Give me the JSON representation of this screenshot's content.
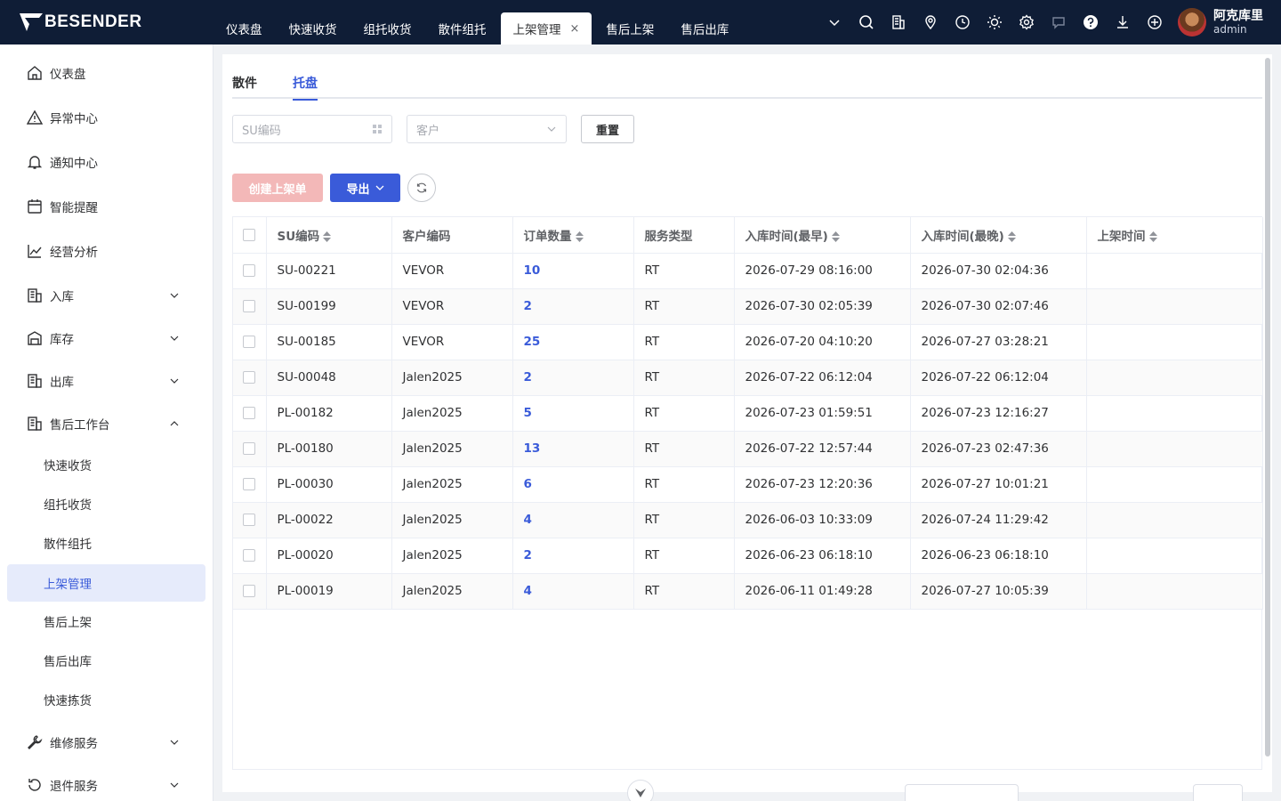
{
  "brand": {
    "name": "BESENDER"
  },
  "topnav": {
    "tabs": [
      {
        "label": "仪表盘"
      },
      {
        "label": "快速收货"
      },
      {
        "label": "组托收货"
      },
      {
        "label": "散件组托"
      },
      {
        "label": "上架管理",
        "active": true,
        "close": "×"
      },
      {
        "label": "售后上架"
      },
      {
        "label": "售后出库"
      }
    ],
    "icons": [
      "chevron-down-icon",
      "search-icon",
      "building-icon",
      "location-icon",
      "clock-icon",
      "sun-icon",
      "gear-icon",
      "chat-icon",
      "help-icon",
      "download-icon",
      "plus-circle-icon"
    ]
  },
  "user": {
    "name": "阿克库里",
    "role": "admin"
  },
  "sidebar": {
    "items": [
      {
        "label": "仪表盘",
        "icon": "home-icon"
      },
      {
        "label": "异常中心",
        "icon": "warning-icon"
      },
      {
        "label": "通知中心",
        "icon": "bell-icon"
      },
      {
        "label": "智能提醒",
        "icon": "calendar-icon"
      },
      {
        "label": "经营分析",
        "icon": "chart-icon"
      },
      {
        "label": "入库",
        "icon": "building-icon",
        "expandable": true
      },
      {
        "label": "库存",
        "icon": "warehouse-icon",
        "expandable": true
      },
      {
        "label": "出库",
        "icon": "building-icon",
        "expandable": true
      },
      {
        "label": "售后工作台",
        "icon": "building-icon",
        "expandable": true,
        "expanded": true
      },
      {
        "label": "快速收货",
        "sub": true
      },
      {
        "label": "组托收货",
        "sub": true
      },
      {
        "label": "散件组托",
        "sub": true
      },
      {
        "label": "上架管理",
        "sub": true,
        "active": true
      },
      {
        "label": "售后上架",
        "sub": true
      },
      {
        "label": "售后出库",
        "sub": true
      },
      {
        "label": "快速拣货",
        "sub": true
      },
      {
        "label": "维修服务",
        "icon": "wrench-icon",
        "expandable": true
      },
      {
        "label": "退件服务",
        "icon": "return-icon",
        "expandable": true
      }
    ]
  },
  "main": {
    "tabs": [
      {
        "label": "散件"
      },
      {
        "label": "托盘",
        "active": true
      }
    ],
    "filters": {
      "su_code_placeholder": "SU编码",
      "customer_placeholder": "客户",
      "reset_label": "重置"
    },
    "actions": {
      "create_label": "创建上架单",
      "export_label": "导出"
    },
    "table": {
      "columns": [
        "SU编码",
        "客户编码",
        "订单数量",
        "服务类型",
        "入库时间(最早)",
        "入库时间(最晚)",
        "上架时间"
      ],
      "rows": [
        {
          "su": "SU-00221",
          "customer": "VEVOR",
          "qty": "10",
          "service": "RT",
          "earliest": "2026-07-29 08:16:00",
          "latest": "2026-07-30 02:04:36",
          "shelved": ""
        },
        {
          "su": "SU-00199",
          "customer": "VEVOR",
          "qty": "2",
          "service": "RT",
          "earliest": "2026-07-30 02:05:39",
          "latest": "2026-07-30 02:07:46",
          "shelved": ""
        },
        {
          "su": "SU-00185",
          "customer": "VEVOR",
          "qty": "25",
          "service": "RT",
          "earliest": "2026-07-20 04:10:20",
          "latest": "2026-07-27 03:28:21",
          "shelved": ""
        },
        {
          "su": "SU-00048",
          "customer": "Jalen2025",
          "qty": "2",
          "service": "RT",
          "earliest": "2026-07-22 06:12:04",
          "latest": "2026-07-22 06:12:04",
          "shelved": ""
        },
        {
          "su": "PL-00182",
          "customer": "Jalen2025",
          "qty": "5",
          "service": "RT",
          "earliest": "2026-07-23 01:59:51",
          "latest": "2026-07-23 12:16:27",
          "shelved": ""
        },
        {
          "su": "PL-00180",
          "customer": "Jalen2025",
          "qty": "13",
          "service": "RT",
          "earliest": "2026-07-22 12:57:44",
          "latest": "2026-07-23 02:47:36",
          "shelved": ""
        },
        {
          "su": "PL-00030",
          "customer": "Jalen2025",
          "qty": "6",
          "service": "RT",
          "earliest": "2026-07-23 12:20:36",
          "latest": "2026-07-27 10:01:21",
          "shelved": ""
        },
        {
          "su": "PL-00022",
          "customer": "Jalen2025",
          "qty": "4",
          "service": "RT",
          "earliest": "2026-06-03 10:33:09",
          "latest": "2026-07-24 11:29:42",
          "shelved": ""
        },
        {
          "su": "PL-00020",
          "customer": "Jalen2025",
          "qty": "2",
          "service": "RT",
          "earliest": "2026-06-23 06:18:10",
          "latest": "2026-06-23 06:18:10",
          "shelved": ""
        },
        {
          "su": "PL-00019",
          "customer": "Jalen2025",
          "qty": "4",
          "service": "RT",
          "earliest": "2026-06-11 01:49:28",
          "latest": "2026-07-27 10:05:39",
          "shelved": ""
        }
      ]
    }
  },
  "colors": {
    "topbar": "#0f1d36",
    "accent": "#3a5bd9",
    "create_disabled": "#f3b8b8",
    "active_menu_bg": "#e6ebfb"
  }
}
